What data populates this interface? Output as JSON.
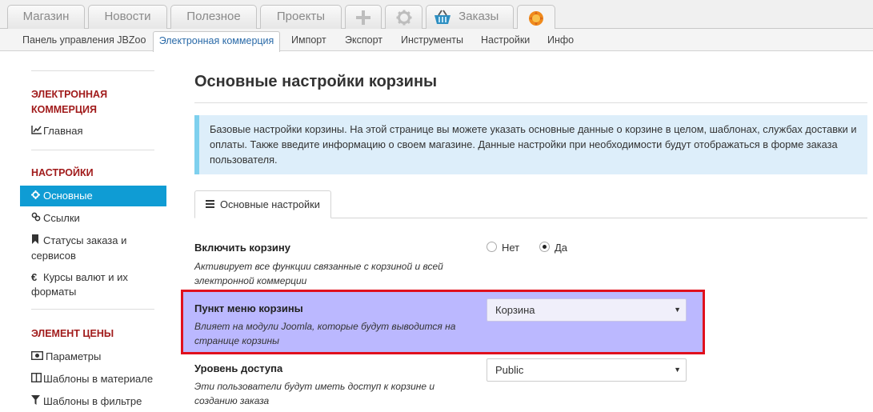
{
  "top_tabs": [
    {
      "label": "Магазин"
    },
    {
      "label": "Новости"
    },
    {
      "label": "Полезное"
    },
    {
      "label": "Проекты"
    },
    {
      "label": "Заказы"
    }
  ],
  "top_icons": [
    "plus-icon",
    "gear-icon",
    "basket-icon",
    "jbzoo-logo-icon"
  ],
  "sub_tabs": [
    "Панель управления JBZoo",
    "Электронная коммерция",
    "Импорт",
    "Экспорт",
    "Инструменты",
    "Настройки",
    "Инфо"
  ],
  "sidebar": {
    "section1": "ЭЛЕКТРОННАЯ КОММЕРЦИЯ",
    "item_main": "Главная",
    "section2": "НАСТРОЙКИ",
    "item_basic": "Основные",
    "item_links": "Ссылки",
    "item_statuses": "Статусы заказа и сервисов",
    "item_currency": "Курсы валют и их форматы",
    "section3": "ЭЛЕМЕНТ ЦЕНЫ",
    "item_params": "Параметры",
    "item_tpl_material": "Шаблоны в материале",
    "item_tpl_filter": "Шаблоны в фильтре"
  },
  "main": {
    "title": "Основные настройки корзины",
    "info": "Базовые настройки корзины. На этой странице вы можете указать основные данные о корзине в целом, шаблонах, службах доставки и оплаты. Также введите информацию о своем магазине. Данные настройки при необходимости будут отображаться в форме заказа пользователя.",
    "tab_label": "Основные настройки",
    "enable": {
      "title": "Включить корзину",
      "desc": "Активирует все функции связанные с корзиной и всей электронной коммерции",
      "opt_no": "Нет",
      "opt_yes": "Да",
      "selected": "Да"
    },
    "menu_item": {
      "title": "Пункт меню корзины",
      "desc": "Влияет на модули Joomla, которые будут выводится на странице корзины",
      "value": "Корзина"
    },
    "access": {
      "title": "Уровень доступа",
      "desc": "Эти пользователи будут иметь доступ к корзине и созданию заказа",
      "value": "Public"
    }
  },
  "colors": {
    "accent_red": "#a11b1b",
    "active_blue": "#0f9cd4",
    "highlight_border": "#e0101d",
    "highlight_fill": "#bbb8ff"
  }
}
